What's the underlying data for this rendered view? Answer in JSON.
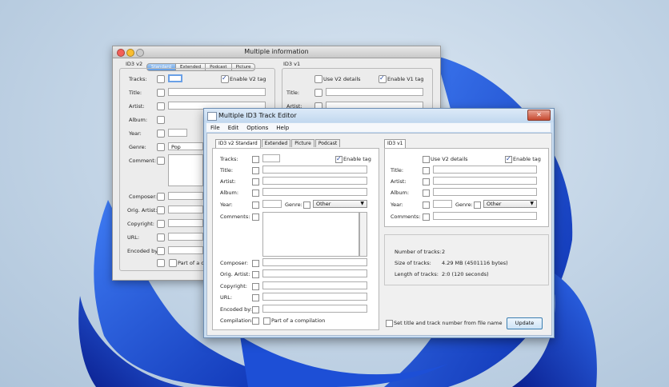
{
  "back_window": {
    "title": "Multiple information",
    "id3v2_label": "ID3 v2",
    "id3v1_label": "ID3 v1",
    "tabs": [
      "Standard",
      "Extended",
      "Podcast",
      "Picture"
    ],
    "labels": {
      "tracks": "Tracks:",
      "title": "Title:",
      "artist": "Artist:",
      "album": "Album:",
      "year": "Year:",
      "genre": "Genre:",
      "comment": "Comment:",
      "composer": "Composer:",
      "orig_artist": "Orig. Artist:",
      "copyright": "Copyright:",
      "url": "URL:",
      "encoded_by": "Encoded by:",
      "part_of_compilation": "Part of a co"
    },
    "enable_v2_tag": "Enable V2 tag",
    "use_v2_details": "Use V2 details",
    "enable_v1_tag": "Enable V1 tag",
    "v1_labels": {
      "title": "Title:",
      "artist": "Artist:"
    },
    "genre_value": "Pop"
  },
  "front_window": {
    "title": "Multiple ID3 Track Editor",
    "close_glyph": "✕",
    "menu": [
      "File",
      "Edit",
      "Options",
      "Help"
    ],
    "tabs": [
      "ID3 v2 Standard",
      "Extended",
      "Picture",
      "Podcast"
    ],
    "v1_tab": "ID3 v1",
    "labels": {
      "tracks": "Tracks:",
      "title": "Title:",
      "artist": "Artist:",
      "album": "Album:",
      "year": "Year:",
      "genre": "Genre:",
      "comments": "Comments:",
      "composer": "Composer:",
      "orig_artist": "Orig. Artist:",
      "copyright": "Copyright:",
      "url": "URL:",
      "encoded_by": "Encoded by:",
      "compilation": "Compilation:"
    },
    "part_of_compilation": "Part of a compilation",
    "enable_tag_v2": "Enable tag",
    "genre_v2": "Other",
    "v1_labels": {
      "title": "Title:",
      "artist": "Artist:",
      "album": "Album:",
      "year": "Year:",
      "genre": "Genre:",
      "comments": "Comments:"
    },
    "use_v2_details": "Use V2 details",
    "enable_tag_v1": "Enable tag",
    "genre_v1": "Other",
    "info": {
      "num_tracks_label": "Number of tracks:",
      "num_tracks_value": "2",
      "size_label": "Size of tracks:",
      "size_value": "4.29 MB (4501116 bytes)",
      "length_label": "Length of tracks:",
      "length_value": "2:0 (120 seconds)"
    },
    "set_title_track": "Set title and track number from file name",
    "update_label": "Update"
  }
}
